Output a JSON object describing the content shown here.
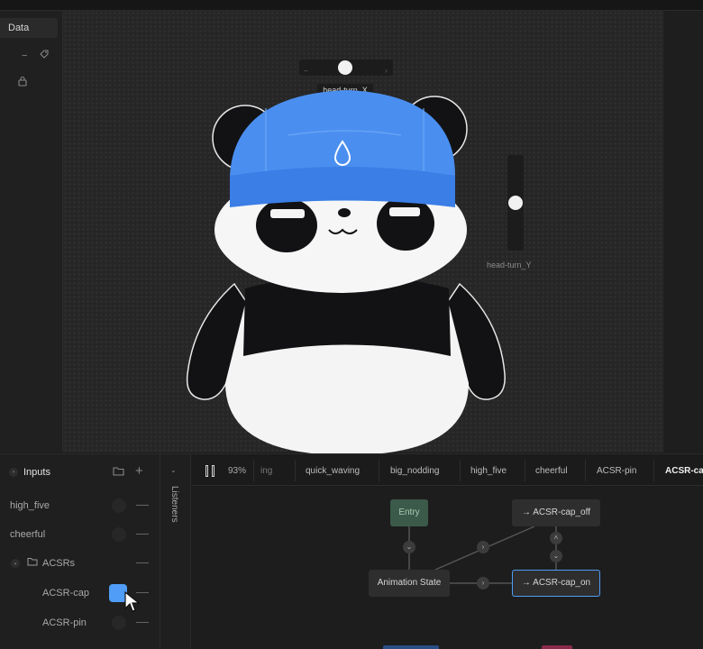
{
  "left_panel": {
    "tab_label": "Data"
  },
  "canvas": {
    "slider_x_label": "head-turn_X",
    "slider_y_label": "head-turn_Y"
  },
  "inputs": {
    "title": "Inputs",
    "rows": [
      {
        "label": "high_five",
        "on": false
      },
      {
        "label": "cheerful",
        "on": false
      },
      {
        "label": "ACSRs",
        "folder": true
      },
      {
        "label": "ACSR-cap",
        "on": true
      },
      {
        "label": "ACSR-pin",
        "on": false
      }
    ]
  },
  "listeners": {
    "label": "Listeners"
  },
  "timeline": {
    "zoom": "93%",
    "tabs": [
      "ing",
      "quick_waving",
      "big_nodding",
      "high_five",
      "cheerful",
      "ACSR-pin",
      "ACSR-ca"
    ],
    "active_tab": "ACSR-ca"
  },
  "graph": {
    "nodes": {
      "entry": "Entry",
      "animation_state": "Animation State",
      "cap_off": "→ ACSR-cap_off",
      "cap_on": "→ ACSR-cap_on"
    }
  },
  "colors": {
    "accent": "#4f9df6",
    "cap": "#4a8ff0",
    "entry_node": "#3b5a4a"
  }
}
